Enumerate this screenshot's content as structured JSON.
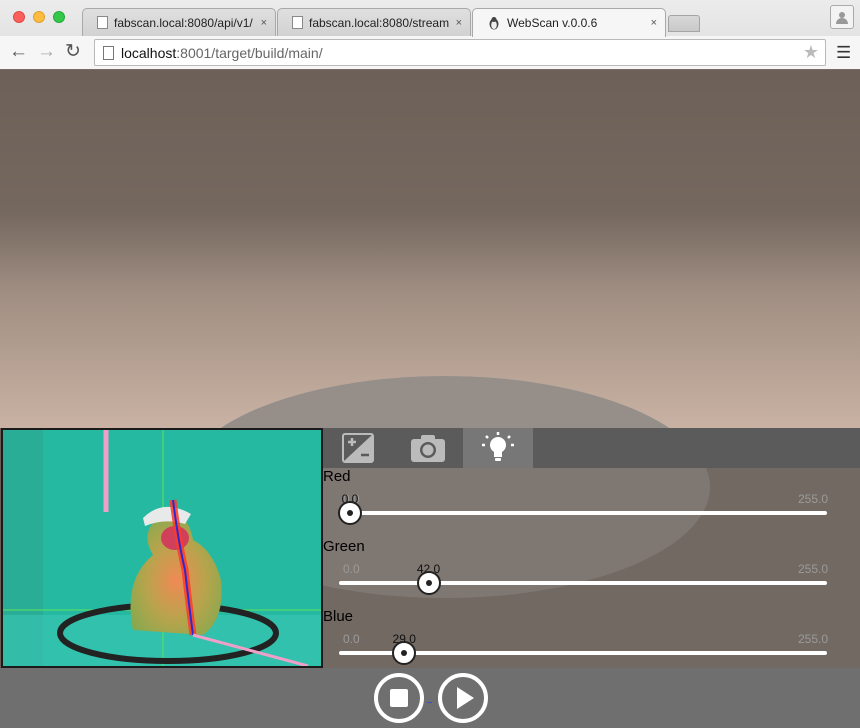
{
  "browser": {
    "tabs": [
      {
        "title": "fabscan.local:8080/api/v1/",
        "active": false
      },
      {
        "title": "fabscan.local:8080/stream",
        "active": false
      },
      {
        "title": "WebScan v.0.0.6",
        "active": true
      }
    ],
    "tab_close_glyph": "×",
    "url_host": "localhost",
    "url_path": ":8001/target/build/main/"
  },
  "panel": {
    "tabs": [
      {
        "icon": "exposure-icon",
        "active": false
      },
      {
        "icon": "camera-icon",
        "active": false
      },
      {
        "icon": "light-bulb-icon",
        "active": true
      }
    ],
    "sliders": [
      {
        "label": "Red",
        "min": "0.0",
        "max": "255.0",
        "value": "0.0",
        "fraction": 0.0
      },
      {
        "label": "Green",
        "min": "0.0",
        "max": "255.0",
        "value": "42.0",
        "fraction": 0.1647
      },
      {
        "label": "Blue",
        "min": "0.0",
        "max": "255.0",
        "value": "29.0",
        "fraction": 0.1137
      }
    ]
  },
  "colors": {
    "accent": "#ffffff",
    "camera_bg": "#22b49c",
    "laser_line": "#ff3a2a"
  },
  "controls": {
    "stop_icon": "stop-icon",
    "play_icon": "play-icon"
  }
}
